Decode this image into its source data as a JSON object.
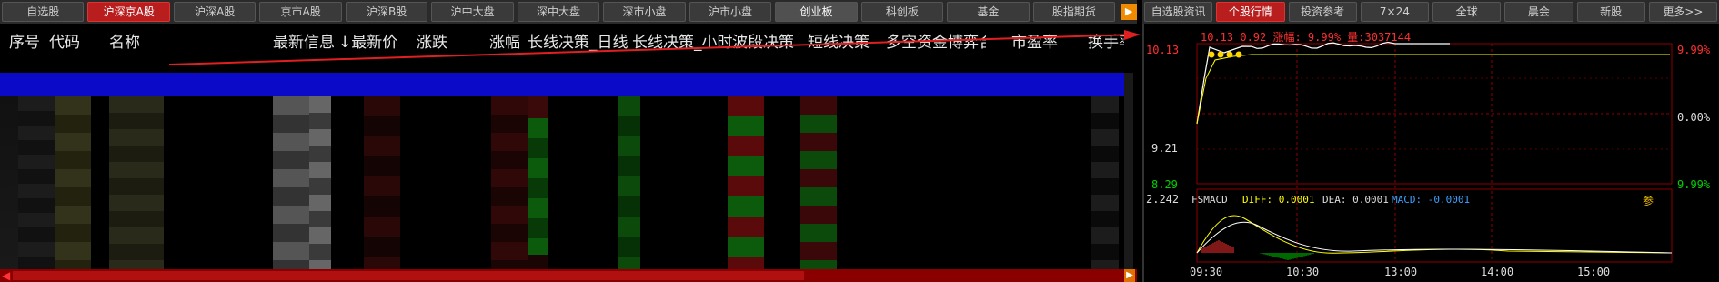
{
  "left_tabs": [
    "自选股",
    "沪深京A股",
    "沪深A股",
    "京市A股",
    "沪深B股",
    "沪中大盘",
    "深中大盘",
    "深市小盘",
    "沪市小盘",
    "创业板",
    "科创板",
    "基金",
    "股指期货"
  ],
  "left_active_index": 1,
  "left_dim_index": 9,
  "right_tabs": [
    "自选股资讯",
    "个股行情",
    "投资参考",
    "7×24",
    "全球",
    "晨会",
    "新股",
    "更多>>"
  ],
  "right_active_index": 1,
  "table_headers": {
    "seq": "序号",
    "code": "代码",
    "name": "名称",
    "info": "最新信息",
    "price": "↓最新价",
    "change": "涨跌",
    "pct": "涨幅",
    "long_day": "长线决策_日线",
    "long_hour": "长线决策_小时",
    "wave": "波段决策",
    "short": "短线决策",
    "fund": "多空资金博弈合",
    "pe": "市盈率",
    "turnover": "换手率"
  },
  "quote": {
    "price_left": "10.13",
    "mid_price": "9.21",
    "low_price": "8.29",
    "pct_top": "9.99%",
    "pct_mid": "0.00%",
    "pct_bot": "9.99%",
    "info_line": "10.13  0.92  涨幅: 9.99%  量:3037144",
    "macd_value": "2.242",
    "macd_label": "FSMACD",
    "diff_label": "DIFF: 0.0001",
    "dea_label": "DEA: 0.0001",
    "macd_val_label": "MACD: -0.0001",
    "param_label": "参",
    "times": [
      "09:30",
      "10:30",
      "13:00",
      "14:00",
      "15:00"
    ]
  },
  "colors": {
    "active_tab": "#b81e1e",
    "up": "#ff3030",
    "down": "#00d000",
    "grid": "#8b0000",
    "price_line": "#ffffff",
    "avg_line": "#ffff00"
  }
}
